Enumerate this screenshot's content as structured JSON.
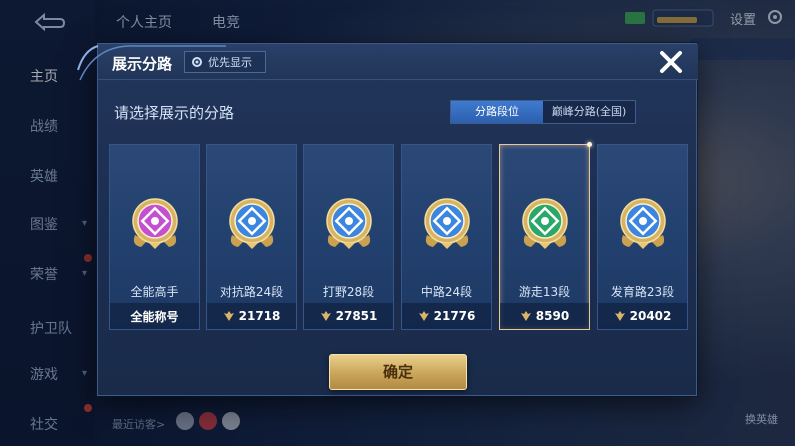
{
  "background": {
    "nav_items": [
      {
        "label": "主页",
        "active": true
      },
      {
        "label": "战绩",
        "active": false
      },
      {
        "label": "英雄",
        "active": false
      },
      {
        "label": "图鉴",
        "active": false
      },
      {
        "label": "荣誉",
        "active": false
      },
      {
        "label": "护卫队",
        "active": false
      },
      {
        "label": "游戏",
        "active": false
      },
      {
        "label": "社交",
        "active": false
      }
    ],
    "top_tabs": [
      "个人主页",
      "电竞"
    ],
    "settings_label": "设置",
    "recent_visitors_label": "最近访客>",
    "change_hero_label": "换英雄"
  },
  "modal": {
    "title": "展示分路",
    "pref_button_label": "优先显示",
    "subtitle": "请选择展示的分路",
    "toggle": [
      "分路段位",
      "巅峰分路(全国)"
    ],
    "toggle_selected_index": 0,
    "cards": [
      {
        "name": "全能高手",
        "bottom": "全能称号",
        "has_score": false,
        "icon": "all-round-badge",
        "color": "#c44fd1",
        "selected": false
      },
      {
        "name": "对抗路24段",
        "bottom": "21718",
        "has_score": true,
        "icon": "clash-lane-badge",
        "color": "#3a86e0",
        "selected": false
      },
      {
        "name": "打野28段",
        "bottom": "27851",
        "has_score": true,
        "icon": "jungle-badge",
        "color": "#3a86e0",
        "selected": false
      },
      {
        "name": "中路24段",
        "bottom": "21776",
        "has_score": true,
        "icon": "mid-lane-badge",
        "color": "#3a86e0",
        "selected": false
      },
      {
        "name": "游走13段",
        "bottom": "8590",
        "has_score": true,
        "icon": "roam-badge",
        "color": "#2aa86a",
        "selected": true
      },
      {
        "name": "发育路23段",
        "bottom": "20402",
        "has_score": true,
        "icon": "farm-lane-badge",
        "color": "#3a86e0",
        "selected": false
      }
    ],
    "confirm_label": "确定"
  }
}
